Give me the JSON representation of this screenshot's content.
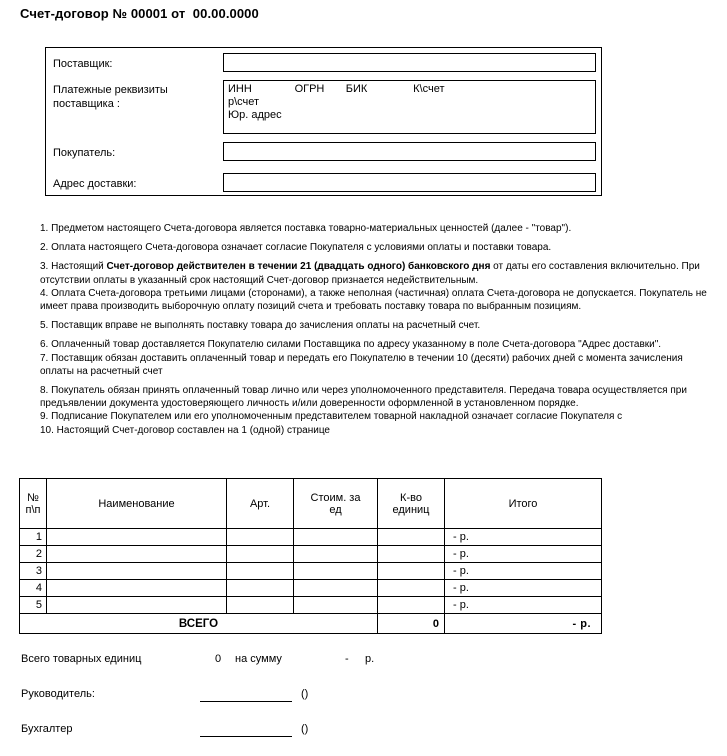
{
  "document": {
    "title": "Счет-договор № 00001 от  00.00.0000"
  },
  "parties": {
    "supplier": {
      "label": "Поставщик:",
      "value": ""
    },
    "requisites": {
      "label": "Платежные реквизиты\nпоставщика :",
      "lines": [
        "ИНН              ОГРН       БИК               К\\счет",
        "р\\счет",
        "Юр. адрес"
      ]
    },
    "buyer": {
      "label": "Покупатель:",
      "value": ""
    },
    "delivery_address": {
      "label": "Адрес доставки:",
      "value": ""
    }
  },
  "terms": [
    {
      "pre": "1. Предметом настоящего Счета-договора является поставка товарно-материальных ценностей (далее - \"товар\").",
      "bold": "",
      "post": ""
    },
    {
      "pre": "2. Оплата настоящего Счета-договора означает согласие Покупателя с условиями оплаты и поставки товара.",
      "bold": "",
      "post": ""
    },
    {
      "pre": "3. Настоящий ",
      "bold": "Счет-договор действителен в течении 21 (двадцать одного) банковского дня",
      "post": " от даты его составления включительно. При отсутствии оплаты в указанный срок настоящий Счет-договор признается недействительным."
    },
    {
      "pre": "4. Оплата Счета-договора третьими лицами (сторонами), а также неполная (частичная) оплата Счета-договора не допускается. Покупатель не имеет права производить выборочную оплату позиций счета и требовать поставку товара по выбранным позициям.",
      "bold": "",
      "post": ""
    },
    {
      "pre": "5. Поставщик вправе не выполнять поставку товара до зачисления оплаты на расчетный счет.",
      "bold": "",
      "post": ""
    },
    {
      "pre": "6. Оплаченный товар доставляется Покупателю силами Поставщика по адресу указанному в поле Счета-договора \"Адрес доставки\".",
      "bold": "",
      "post": ""
    },
    {
      "pre": "7. Поставщик обязан доставить оплаченный товар и передать его Покупателю в течении 10 (десяти) рабочих дней с момента зачисления оплаты на расчетный счет",
      "bold": "",
      "post": ""
    },
    {
      "pre": "8. Покупатель обязан принять оплаченный товар лично или через уполномоченного представителя. Передача товара осуществляется при предъявлении документа удостоверяющего личность и/или доверенности оформленной в установленном порядке.",
      "bold": "",
      "post": ""
    },
    {
      "pre": "9. Подписание Покупателем или его уполномоченным представителем товарной накладной означает согласие Покупателя с",
      "bold": "",
      "post": ""
    },
    {
      "pre": "10. Настоящий Счет-договор составлен на 1 (одной) странице",
      "bold": "",
      "post": ""
    }
  ],
  "goods_table": {
    "headers": {
      "num": "№\nп\\п",
      "name": "Наименование",
      "article": "Арт.",
      "price": "Стоим. за\nед",
      "quantity": "К-во\nединиц",
      "total": "Итого"
    },
    "rows": [
      {
        "num": "1",
        "name": "",
        "article": "",
        "price": "",
        "quantity": "",
        "total": "-  р."
      },
      {
        "num": "2",
        "name": "",
        "article": "",
        "price": "",
        "quantity": "",
        "total": "-  р."
      },
      {
        "num": "3",
        "name": "",
        "article": "",
        "price": "",
        "quantity": "",
        "total": "-  р."
      },
      {
        "num": "4",
        "name": "",
        "article": "",
        "price": "",
        "quantity": "",
        "total": "-  р."
      },
      {
        "num": "5",
        "name": "",
        "article": "",
        "price": "",
        "quantity": "",
        "total": "-  р."
      }
    ],
    "summary": {
      "label": "ВСЕГО",
      "quantity": "0",
      "total": "-   р."
    }
  },
  "footer": {
    "units_label": "Всего товарных единиц",
    "units_value": "0",
    "sum_label": "на сумму",
    "sum_dash": "-",
    "sum_currency": "р.",
    "director_label": "Руководитель:",
    "director_parens": "()",
    "accountant_label": "Бухгалтер",
    "accountant_parens": "()"
  }
}
